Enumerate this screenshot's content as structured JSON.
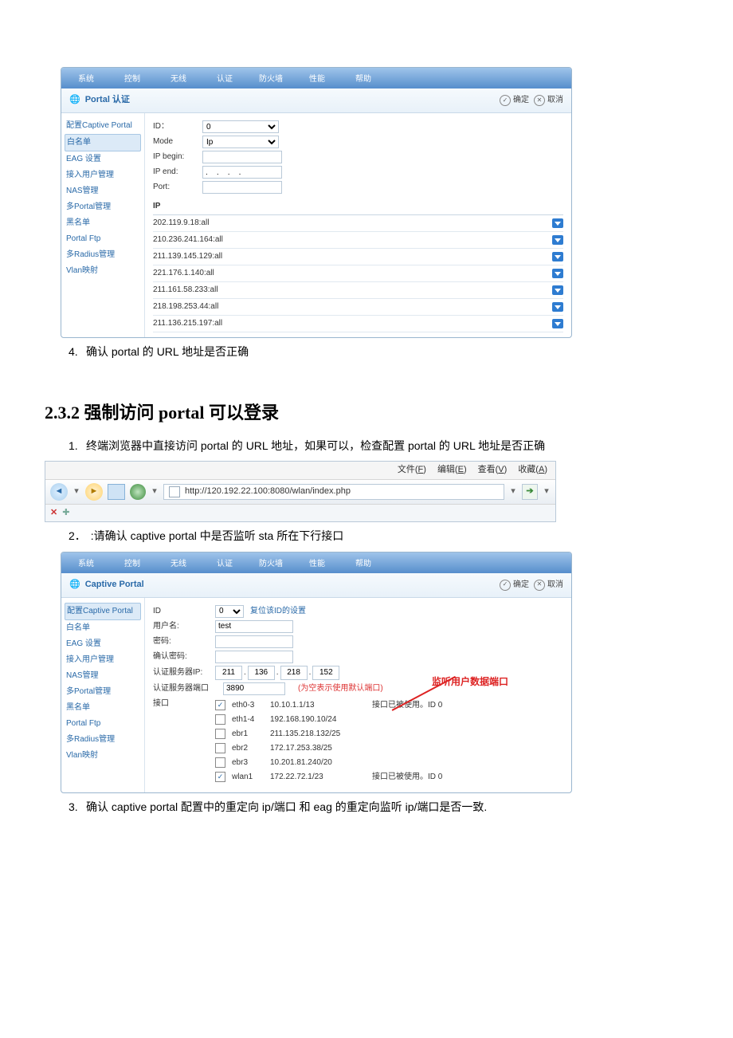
{
  "topnav": [
    "系统",
    "控制",
    "无线",
    "认证",
    "防火墙",
    "性能",
    "帮助"
  ],
  "panel1": {
    "title": "Portal 认证",
    "ok": "确定",
    "cancel": "取消",
    "sidebar": [
      "配置Captive Portal",
      "白名单",
      "EAG 设置",
      "接入用户管理",
      "NAS管理",
      "多Portal管理",
      "黑名单",
      "Portal Ftp",
      "多Radius管理",
      "Vlan映射"
    ],
    "sidebar_active": 1,
    "id_label": "ID：",
    "id_value": "0",
    "mode_label": "Mode",
    "mode_value": "Ip",
    "ip_begin_label": "IP begin:",
    "ip_end_label": "IP end:",
    "ip_end_value": ".    .    .    .",
    "port_label": "Port:",
    "ip_header": "IP",
    "ip_list": [
      "202.119.9.18:all",
      "210.236.241.164:all",
      "211.139.145.129:all",
      "221.176.1.140:all",
      "211.161.58.233:all",
      "218.198.253.44:all",
      "211.136.215.197:all"
    ]
  },
  "step4": {
    "num": "4.",
    "text": "确认 portal 的 URL 地址是否正确"
  },
  "section_title": "2.3.2  强制访问 portal 可以登录",
  "step1": {
    "num": "1.",
    "text": "终端浏览器中直接访问 portal 的 URL 地址，如果可以，检查配置 portal 的 URL 地址是否正确"
  },
  "browser": {
    "menu": [
      {
        "pre": "文件(",
        "key": "F",
        "post": ")"
      },
      {
        "pre": "编辑(",
        "key": "E",
        "post": ")"
      },
      {
        "pre": "查看(",
        "key": "V",
        "post": ")"
      },
      {
        "pre": "收藏(",
        "key": "A",
        "post": ")"
      }
    ],
    "url": "http://120.192.22.100:8080/wlan/index.php"
  },
  "step2": {
    "num": "2．",
    "text": ":请确认 captive portal  中是否监听 sta 所在下行接口"
  },
  "panel2": {
    "title": "Captive Portal",
    "ok": "确定",
    "cancel": "取消",
    "sidebar": [
      "配置Captive Portal",
      "白名单",
      "EAG 设置",
      "接入用户管理",
      "NAS管理",
      "多Portal管理",
      "黑名单",
      "Portal Ftp",
      "多Radius管理",
      "Vlan映射"
    ],
    "sidebar_active": 0,
    "id_label": "ID",
    "id_value": "0",
    "id_link": "复位该ID的设置",
    "user_label": "用户名:",
    "user_value": "test",
    "pwd_label": "密码:",
    "pwd2_label": "确认密码:",
    "authip_label": "认证服务器IP:",
    "authip": [
      "211",
      "136",
      "218",
      "152"
    ],
    "authport_label": "认证服务器端口",
    "authport_value": "3890",
    "authport_note": "(为空表示使用默认端口)",
    "iface_label": "接口",
    "callout": "监听用户数据端口",
    "note0": "接口已被使用。ID 0",
    "note5": "接口已被使用。ID 0",
    "interfaces": [
      {
        "checked": true,
        "name": "eth0-3",
        "ip": "10.10.1.1/13"
      },
      {
        "checked": false,
        "name": "eth1-4",
        "ip": "192.168.190.10/24"
      },
      {
        "checked": false,
        "name": "ebr1",
        "ip": "211.135.218.132/25"
      },
      {
        "checked": false,
        "name": "ebr2",
        "ip": "172.17.253.38/25"
      },
      {
        "checked": false,
        "name": "ebr3",
        "ip": "10.201.81.240/20"
      },
      {
        "checked": true,
        "name": "wlan1",
        "ip": "172.22.72.1/23"
      }
    ]
  },
  "step3": {
    "num": "3.",
    "text": "确认 captive portal 配置中的重定向 ip/端口  和  eag 的重定向监听 ip/端口是否一致."
  }
}
